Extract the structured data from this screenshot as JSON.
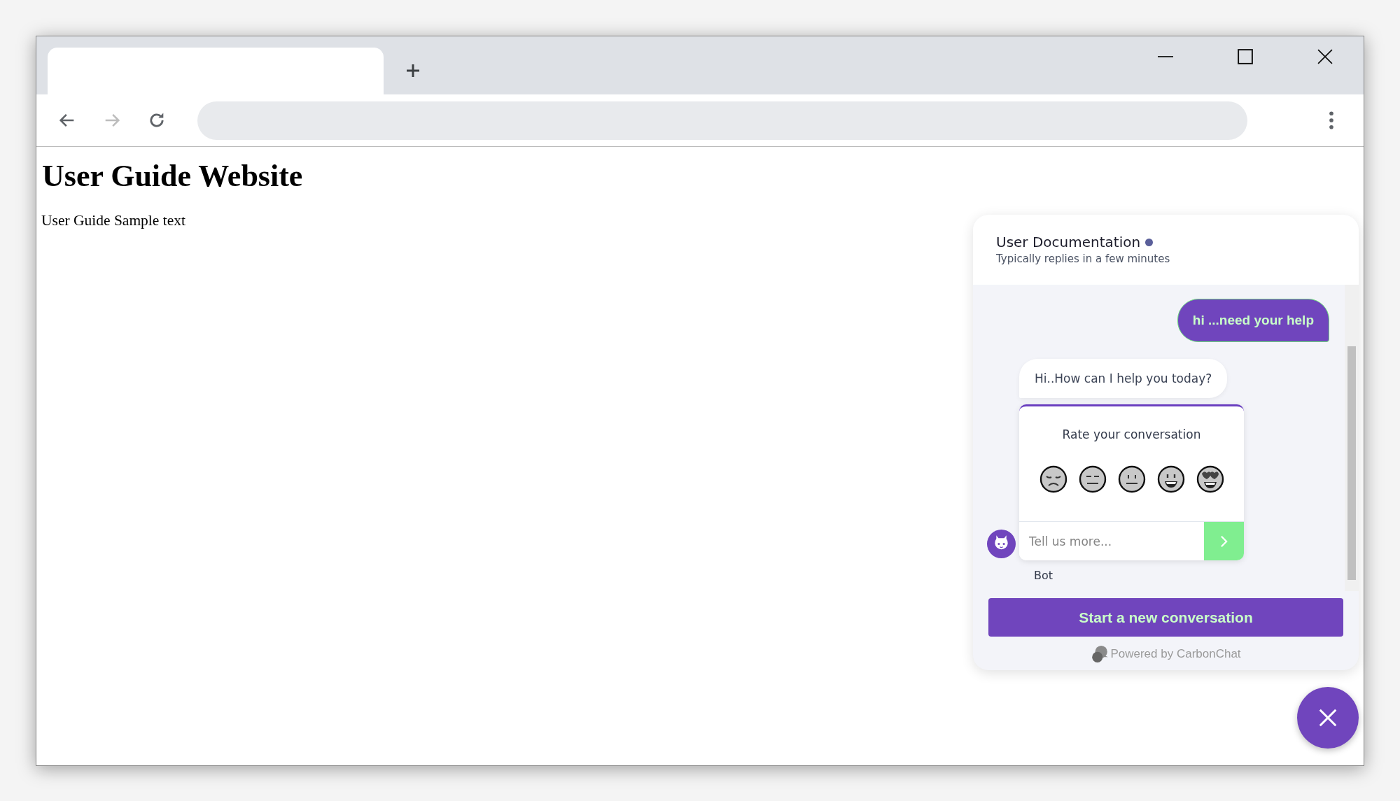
{
  "page": {
    "heading": "User Guide Website",
    "paragraph": "User Guide Sample text"
  },
  "chat": {
    "title": "User Documentation",
    "subtitle": "Typically replies in a few minutes",
    "messages": [
      {
        "kind": "user",
        "text": "hi ...need your help"
      },
      {
        "kind": "bot",
        "text": "Hi..How can I help you today?"
      }
    ],
    "rating": {
      "title": "Rate your conversation",
      "placeholder": "Tell us more..."
    },
    "sender_label": "Bot",
    "new_conversation_button": "Start a new conversation",
    "powered_by": "Powered by CarbonChat"
  }
}
